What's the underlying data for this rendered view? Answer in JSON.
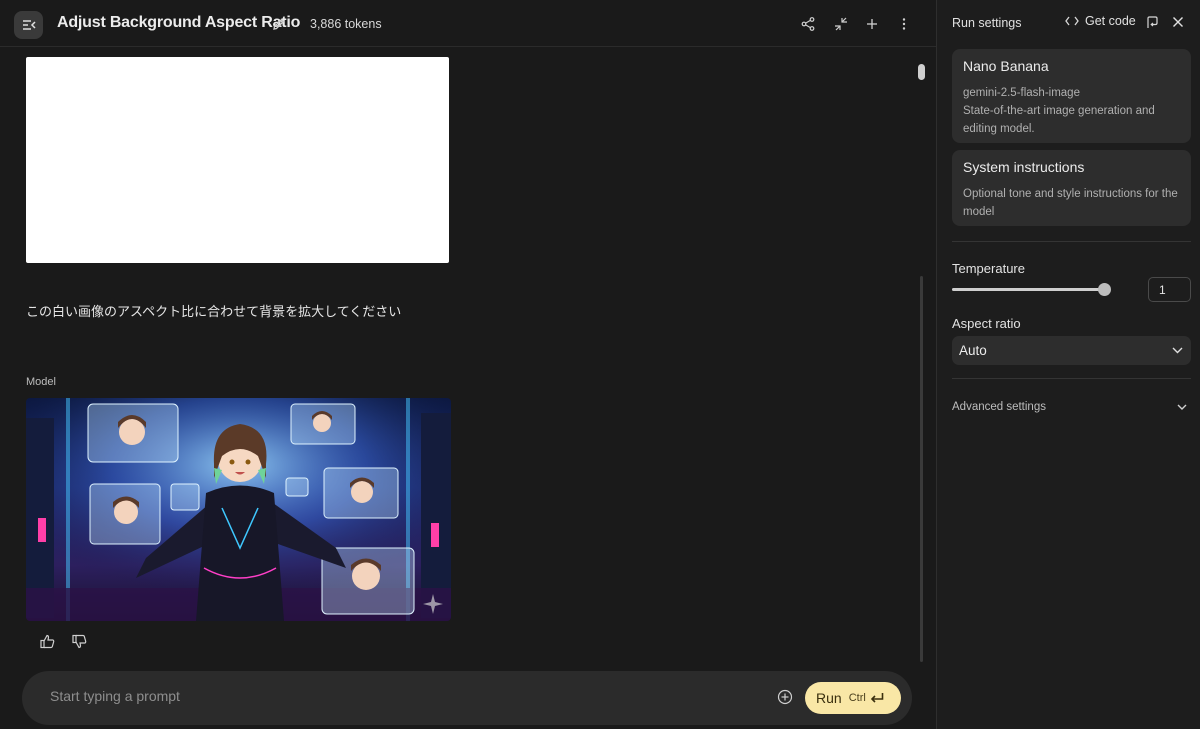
{
  "header": {
    "title": "Adjust Background Aspect Ratio",
    "tokens": "3,886 tokens"
  },
  "chat": {
    "user_message": "この白い画像のアスペクト比に合わせて背景を拡大してください",
    "model_label": "Model"
  },
  "prompt": {
    "placeholder": "Start typing a prompt",
    "run_label": "Run",
    "run_shortcut": "Ctrl"
  },
  "run_settings": {
    "title": "Run settings",
    "get_code": "Get code",
    "model": {
      "name": "Nano Banana",
      "id": "gemini-2.5-flash-image",
      "description": "State-of-the-art image generation and editing model."
    },
    "system_instructions": {
      "title": "System instructions",
      "hint": "Optional tone and style instructions for the model"
    },
    "temperature": {
      "label": "Temperature",
      "value": "1",
      "fraction": 1.0
    },
    "aspect_ratio": {
      "label": "Aspect ratio",
      "selected": "Auto"
    },
    "advanced": "Advanced settings"
  }
}
